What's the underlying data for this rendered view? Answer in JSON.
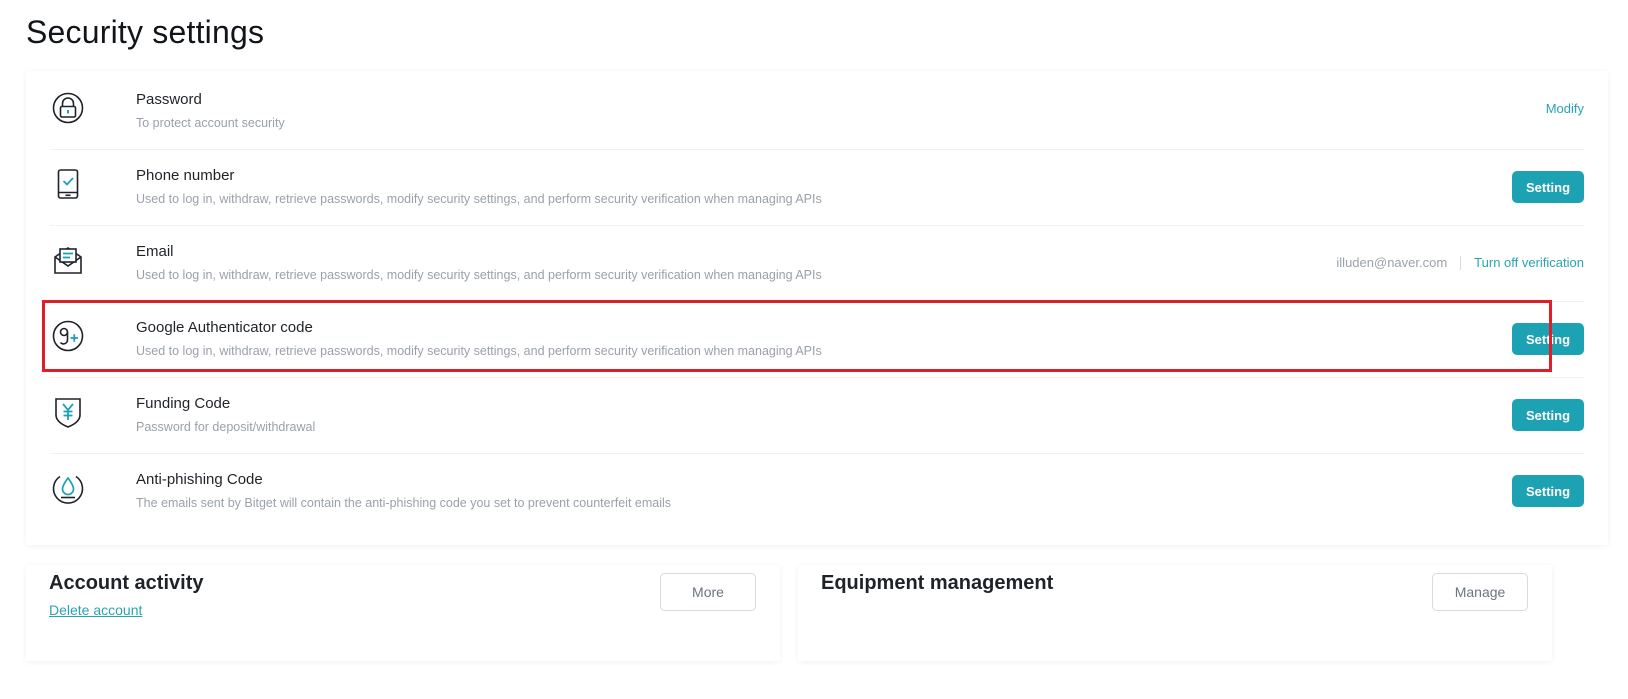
{
  "page": {
    "title": "Security settings"
  },
  "security_items": [
    {
      "title": "Password",
      "description": "To protect account security",
      "action": "Modify",
      "icon": "lock-icon"
    },
    {
      "title": "Phone number",
      "description": "Used to log in, withdraw, retrieve passwords, modify security settings, and perform security verification when managing APIs",
      "action": "Setting",
      "icon": "phone-check-icon"
    },
    {
      "title": "Email",
      "description": "Used to log in, withdraw, retrieve passwords, modify security settings, and perform security verification when managing APIs",
      "email": "illuden@naver.com",
      "action": "Turn off verification",
      "icon": "envelope-icon"
    },
    {
      "title": "Google Authenticator code",
      "description": "Used to log in, withdraw, retrieve passwords, modify security settings, and perform security verification when managing APIs",
      "action": "Setting",
      "icon": "google-plus-icon",
      "highlighted": true
    },
    {
      "title": "Funding Code",
      "description": "Password for deposit/withdrawal",
      "action": "Setting",
      "icon": "yen-shield-icon"
    },
    {
      "title": "Anti-phishing Code",
      "description": "The emails sent by Bitget will contain the anti-phishing code you set to prevent counterfeit emails",
      "action": "Setting",
      "icon": "water-drop-icon"
    }
  ],
  "account_activity": {
    "title": "Account activity",
    "delete_link": "Delete account",
    "button": "More"
  },
  "equipment_management": {
    "title": "Equipment management",
    "button": "Manage"
  },
  "colors": {
    "accent": "#1da2b4",
    "link": "#2aa3b0",
    "highlight": "#e01e2a",
    "muted_text": "#9aa1ab"
  }
}
